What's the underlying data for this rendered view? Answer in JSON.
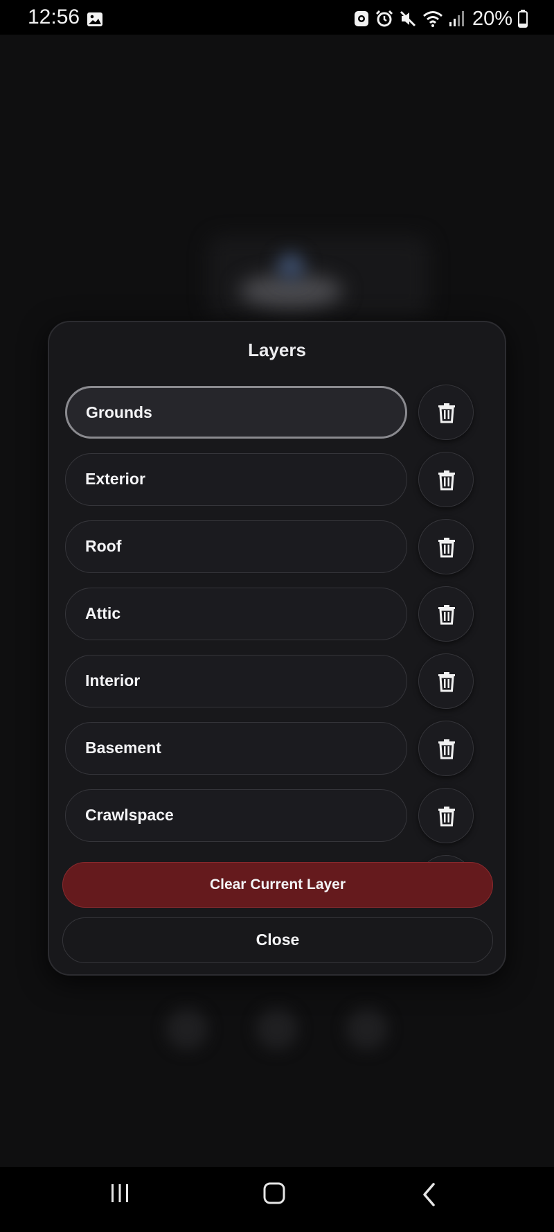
{
  "status_bar": {
    "time": "12:56",
    "battery_percent": "20%",
    "icons": [
      "gallery-icon",
      "android-debug-icon",
      "alarm-icon",
      "mute-icon",
      "wifi-icon",
      "signal-icon",
      "battery-icon"
    ]
  },
  "modal": {
    "title": "Layers",
    "layers": [
      {
        "label": "Grounds",
        "active": true
      },
      {
        "label": "Exterior",
        "active": false
      },
      {
        "label": "Roof",
        "active": false
      },
      {
        "label": "Attic",
        "active": false
      },
      {
        "label": "Interior",
        "active": false
      },
      {
        "label": "Basement",
        "active": false
      },
      {
        "label": "Crawlspace",
        "active": false
      }
    ],
    "delete_icon": "trash-icon",
    "clear_label": "Clear Current Layer",
    "close_label": "Close"
  },
  "nav_bar": {
    "icons": [
      "recent-apps-icon",
      "home-icon",
      "back-icon"
    ]
  },
  "colors": {
    "background": "#0f0f10",
    "modal_bg": "#18181b",
    "clear_button": "#651a1d",
    "text": "#f4f4f6"
  }
}
